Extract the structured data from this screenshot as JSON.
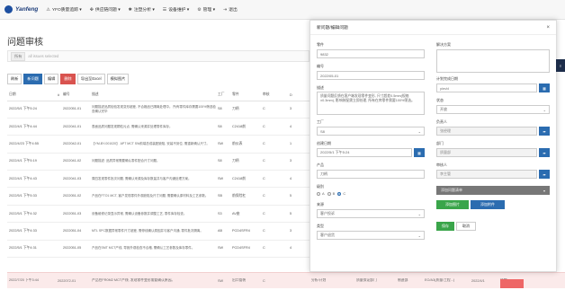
{
  "topbar": {
    "logo": "Yanfeng",
    "nav": [
      {
        "icon": "warning-icon",
        "glyph": "⚠",
        "label": "YFO质量追踪 ▾"
      },
      {
        "icon": "flow-icon",
        "glyph": "✤",
        "label": "供应链问题 ▾"
      },
      {
        "icon": "chart-icon",
        "glyph": "✱",
        "label": "注塑分析 ▾"
      },
      {
        "icon": "list-icon",
        "glyph": "☰",
        "label": "设备维护 ▾"
      },
      {
        "icon": "gear-icon",
        "glyph": "⚙",
        "label": "管理 ▾"
      },
      {
        "icon": "logout-icon",
        "glyph": "⇥",
        "label": "退出"
      }
    ]
  },
  "page": {
    "title": "问题审核",
    "filter_chip": "所有",
    "filter_text": "all issues selected"
  },
  "toolbar": {
    "buttons": [
      {
        "label": "刷新",
        "style": "white"
      },
      {
        "label": "新问题",
        "style": "blue"
      },
      {
        "label": "编辑",
        "style": "white"
      },
      {
        "label": "删除",
        "style": "red"
      },
      {
        "label": "导出至Excel",
        "style": "white"
      },
      {
        "label": "模拟图片",
        "style": "white"
      }
    ]
  },
  "table": {
    "headers": [
      "日期",
      "#",
      "编号",
      "描述",
      "工厂",
      "零件",
      "审核",
      "D"
    ],
    "rows": [
      {
        "date": "2022/5/1 下午5:24",
        "mark": "",
        "no": "2022051-01",
        "desc": "问题描述品质检验发现变形超差, 不合格品已隔离处理中。 所有零件库存需要100%筛选检查确认完毕",
        "plant": "S8",
        "part": "刀柄",
        "audit": "C",
        "d": "3"
      },
      {
        "date": "2022/4/1 下午4:44",
        "mark": "",
        "no": "2022041-01",
        "desc": "表面品质问题发现颗粒污点, 需确认来源并处理零件库存。",
        "plant": "S8",
        "part": "C2418前",
        "audit": "C",
        "d": "4"
      },
      {
        "date": "2022/4/23 下午4:55",
        "mark": "",
        "no": "2022042-01",
        "desc": "【YM-BY-001020】 APT MCT SW前端总成装配缺陷, 安装不到位, 需重新确认尺寸。",
        "plant": "SW",
        "part": "前仪表",
        "audit": "C",
        "d": "1"
      },
      {
        "date": "2022/4/1 下午5:19",
        "mark": "",
        "no": "2022041-02",
        "desc": "问题描述: 品质异常需要确认零件配合尺寸问题。",
        "plant": "S8",
        "part": "刀柄",
        "audit": "C",
        "d": "3"
      },
      {
        "date": "2022/4/1 下午4:43",
        "mark": "",
        "no": "2022041-03",
        "desc": "周四发现零件批次问题, 需确认来源及库存数量并与客户沟通处理方案。",
        "plant": "SW",
        "part": "C2418前",
        "audit": "C",
        "d": "4"
      },
      {
        "date": "2022/5/1 下午5:33",
        "mark": "",
        "no": "2022051-02",
        "desc": "产品在FTO1 MCT, 客户发现零件外观缺陷及尺寸问题, 需要确认原材料及工艺参数。",
        "plant": "SB",
        "part": "前保险杠",
        "audit": "C",
        "d": "5"
      },
      {
        "date": "2022/5/1 下午4:32",
        "mark": "",
        "no": "2022051-03",
        "desc": "设备维修记录显示异常, 需确认设备参数并调整工艺, 零件库存检查。",
        "plant": "S3",
        "part": "AV座",
        "audit": "C",
        "d": "5"
      },
      {
        "date": "2022/5/1 下午4:33",
        "mark": "",
        "no": "2022051-04",
        "desc": "MTL SPC数据异常零件尺寸超差, 需停线确认原因并与客户沟通, 零件批次隔离。",
        "plant": "AB",
        "part": "PCD4SFR4",
        "audit": "C",
        "d": "3"
      },
      {
        "date": "2022/5/1 下午4:31",
        "mark": "",
        "no": "2022051-05",
        "desc": "产品在SMT MCT产线, 导致外观检查不合格, 需确认工艺参数及库存零件。",
        "plant": "SW",
        "part": "PCD4SFR4",
        "audit": "C",
        "d": "4"
      }
    ]
  },
  "bottom_row": {
    "date": "2022/7/20 下午3:44",
    "no": "2022072-01",
    "desc": "产品在FR0M2 MCT产线, 发现零件变形需要确认原因。",
    "plant": "SW",
    "part": "出口管装",
    "audit": "C",
    "col1": "分析/计划",
    "col2": "质量保证部门",
    "col3": "制造部",
    "col4": "EO/A3(质量/工程...)",
    "col5": "2022/4/1",
    "col6": "待定"
  },
  "modal": {
    "title": "新问题/编辑问题",
    "close": "×",
    "fields": {
      "part_label": "零件",
      "part_value": "9832",
      "no_label": "编号",
      "no_value": "2022/05-01",
      "desc_label": "描述",
      "desc_value": "质量问题反馈在客户端发现零件变形, 尺寸超差0.5mm(规格±0.3mm), 影响装配需立即处理, 所有在库零件需要100%筛选。",
      "plant_label": "工厂",
      "plant_value": "S8",
      "date_label": "创建日期",
      "date_value": "2022/5/1 下午5:24",
      "product_label": "产品",
      "product_value": "刀柄",
      "level_label": "级别",
      "level_options": [
        "A",
        "B",
        "C"
      ],
      "level_selected": "C",
      "source_label": "来源",
      "source_value": "客户投诉",
      "type_label": "类型",
      "type_value": "客户退货",
      "plan_label": "解决方案",
      "plan_value": "",
      "due_label": "计划完成日期",
      "due_placeholder": "y/m/d",
      "status_label": "状态",
      "status_value": "开放",
      "owner_label": "负责人",
      "owner_value": "张经理",
      "dept_label": "部门",
      "dept_value": "质量部",
      "reviewer_label": "审核人",
      "reviewer_value": "李主管"
    },
    "sub_bar_label": "添加问题清单",
    "sub_bar_icon": "▾",
    "btn_add_photo": "添加图片",
    "btn_add_file": "添加附件",
    "btn_save": "保存",
    "btn_cancel": "取消"
  },
  "side_tab_label": "≡"
}
